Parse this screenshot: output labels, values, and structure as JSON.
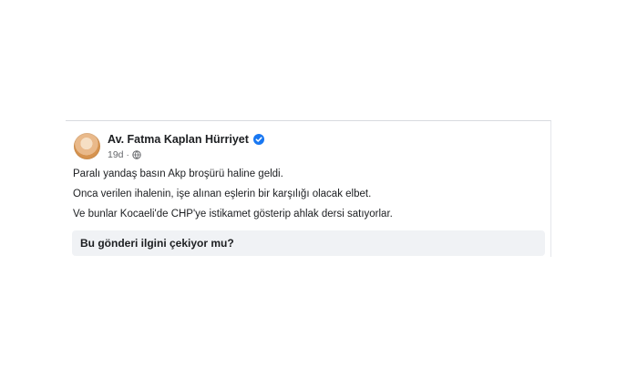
{
  "post": {
    "author": "Av. Fatma Kaplan Hürriyet",
    "time": "19d",
    "separator": "·",
    "icons": {
      "verified": "verified-badge-icon",
      "audience": "globe-icon"
    },
    "colors": {
      "verified": "#1877f2",
      "prompt_bg": "#f0f2f5",
      "text": "#1c1e21",
      "meta": "#65676b"
    },
    "lines": [
      "Paralı yandaş basın Akp broşürü haline geldi.",
      "Onca verilen ihalenin, işe alınan eşlerin bir karşılığı olacak elbet.",
      "Ve bunlar Kocaeli'de CHP'ye istikamet gösterip ahlak dersi satıyorlar."
    ],
    "prompt": "Bu gönderi ilgini çekiyor mu?"
  }
}
